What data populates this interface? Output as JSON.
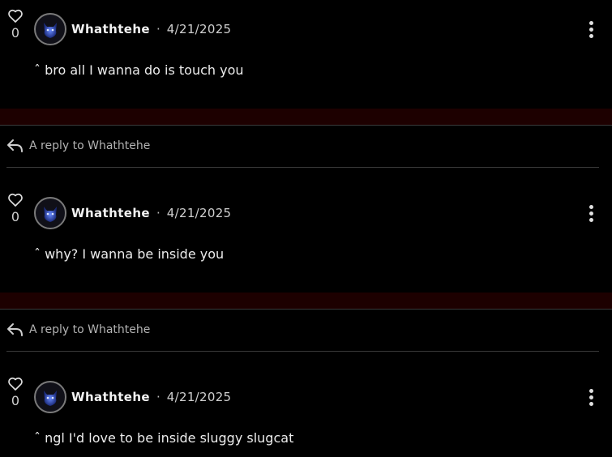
{
  "comments": [
    {
      "likes": "0",
      "user": "Whathtehe",
      "separator": "·",
      "date": "4/21/2025",
      "text": "ˆ bro all I wanna do is touch you"
    },
    {
      "likes": "0",
      "user": "Whathtehe",
      "separator": "·",
      "date": "4/21/2025",
      "text": "ˆ why? I wanna be inside you"
    },
    {
      "likes": "0",
      "user": "Whathtehe",
      "separator": "·",
      "date": "4/21/2025",
      "text": "ˆ ngl I'd love to be inside sluggy slugcat"
    }
  ],
  "reply_label": "A reply to Whathtehe",
  "icons": {
    "like": "heart-outline-icon",
    "more": "vertical-ellipsis-icon",
    "reply": "reply-arrow-icon",
    "avatar": "blue-creature-avatar"
  },
  "colors": {
    "background": "#000000",
    "divider": "#1d0000",
    "text": "#e9e9e9",
    "muted": "#b3b3b3"
  }
}
